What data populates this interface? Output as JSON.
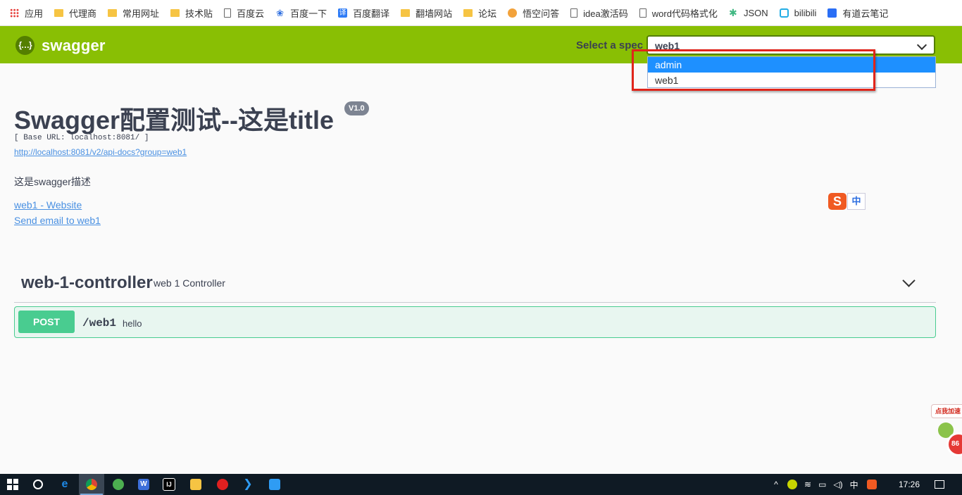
{
  "bookmarks": [
    {
      "label": "应用",
      "icon": "apps-icon",
      "cls": "ic-apps"
    },
    {
      "label": "代理商",
      "icon": "folder-icon",
      "cls": "ic-folder"
    },
    {
      "label": "常用网址",
      "icon": "folder-icon",
      "cls": "ic-folder"
    },
    {
      "label": "技术贴",
      "icon": "folder-icon",
      "cls": "ic-folder"
    },
    {
      "label": "百度云",
      "icon": "page-icon",
      "cls": "ic-page"
    },
    {
      "label": "百度一下",
      "icon": "baidu-paw-icon",
      "cls": "ic-baidu"
    },
    {
      "label": "百度翻译",
      "icon": "baidu-translate-icon",
      "cls": "ic-fanyi"
    },
    {
      "label": "翻墙网站",
      "icon": "folder-icon",
      "cls": "ic-folder"
    },
    {
      "label": "论坛",
      "icon": "folder-icon",
      "cls": "ic-folder"
    },
    {
      "label": "悟空问答",
      "icon": "wukong-icon",
      "cls": "ic-wukong"
    },
    {
      "label": "idea激活码",
      "icon": "page-icon",
      "cls": "ic-page"
    },
    {
      "label": "word代码格式化",
      "icon": "page-icon",
      "cls": "ic-page"
    },
    {
      "label": "JSON",
      "icon": "json-icon",
      "cls": "ic-json"
    },
    {
      "label": "bilibili",
      "icon": "bilibili-icon",
      "cls": "ic-bili"
    },
    {
      "label": "有道云笔记",
      "icon": "youdao-icon",
      "cls": "ic-youdao"
    }
  ],
  "topbar": {
    "logo_text": "swagger",
    "logo_mark": "{…}",
    "spec_label": "Select a spec",
    "spec_selected": "web1",
    "spec_options": [
      {
        "label": "admin",
        "highlighted": true
      },
      {
        "label": "web1",
        "highlighted": false
      }
    ]
  },
  "info": {
    "title": "Swagger配置测试--这是title",
    "version": "V1.0",
    "base_url": "[ Base URL: localhost:8081/ ]",
    "doc_link": "http://localhost:8081/v2/api-docs?group=web1",
    "description": "这是swagger描述",
    "website_link": "web1 - Website",
    "email_link": "Send email to web1"
  },
  "ime": {
    "logo": "S",
    "mode": "中"
  },
  "controller": {
    "name": "web-1-controller",
    "description": "web 1 Controller",
    "operations": [
      {
        "method": "POST",
        "path": "/web1",
        "summary": "hello"
      }
    ]
  },
  "widget": {
    "bubble": "点我加速",
    "badge": "86"
  },
  "taskbar": {
    "ime_lang": "中",
    "time": "17:26"
  },
  "colors": {
    "topbar": "#89bf04",
    "post": "#49cc90",
    "link": "#4990e2",
    "highlight": "#1e90ff",
    "annotation": "#e1251b"
  }
}
